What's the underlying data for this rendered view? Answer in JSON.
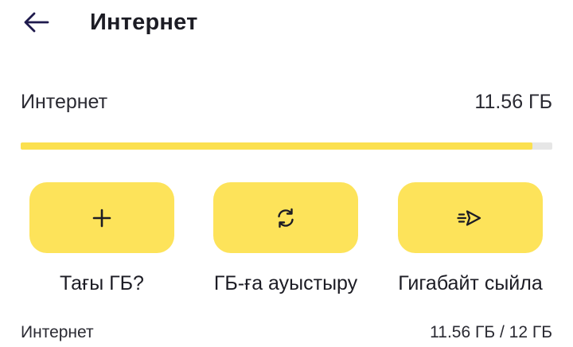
{
  "header": {
    "title": "Интернет",
    "back_icon": "arrow-left-icon"
  },
  "balance": {
    "label": "Интернет",
    "value": "11.56 ГБ",
    "progress_fraction": 0.9633
  },
  "actions": [
    {
      "label": "Тағы ГБ?",
      "icon": "plus-icon"
    },
    {
      "label": "ГБ-ға ауыстыру",
      "icon": "refresh-icon"
    },
    {
      "label": "Гигабайт сыйла",
      "icon": "send-icon"
    }
  ],
  "summary": {
    "label": "Интернет",
    "value": "11.56 ГБ / 12 ГБ"
  },
  "colors": {
    "accent": "#fde35a",
    "progress": "#fbe04f",
    "track": "#e6e6e6",
    "back_arrow": "#1f1a4d",
    "text": "#1c1c24"
  }
}
